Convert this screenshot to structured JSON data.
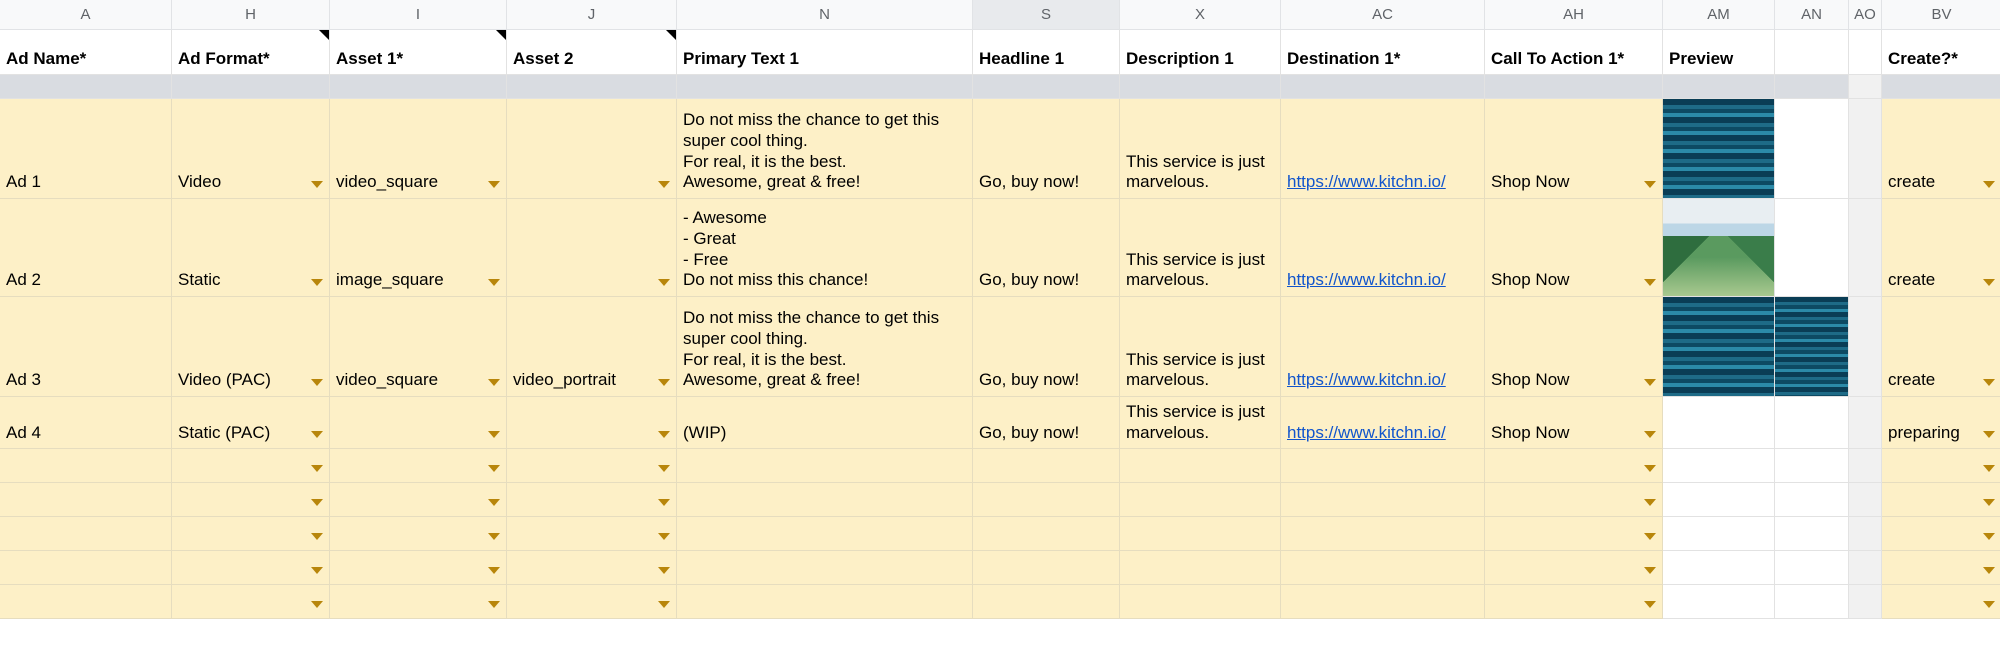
{
  "columns": [
    "A",
    "H",
    "I",
    "J",
    "N",
    "S",
    "X",
    "AC",
    "AH",
    "AM",
    "AN",
    "AO",
    "BV"
  ],
  "selectedColumnIndex": 5,
  "cornerMarkColumns": [
    1,
    2,
    3
  ],
  "fields": [
    "Ad Name*",
    "Ad Format*",
    "Asset 1*",
    "Asset 2",
    "Primary Text 1",
    "Headline 1",
    "Description 1",
    "Destination 1*",
    "Call To Action 1*",
    "Preview",
    "",
    "",
    "Create?*"
  ],
  "rows": [
    {
      "ad_name": "Ad 1",
      "ad_format": "Video",
      "asset1": "video_square",
      "asset2": "",
      "primary": "Do not miss the chance to get this super cool thing.\nFor real, it is the best.\nAwesome, great & free!",
      "headline": "Go, buy now!",
      "description": "This service is just marvelous.",
      "destination": "https://www.kitchn.io/",
      "cta": "Shop Now",
      "preview": "water",
      "preview2": "",
      "create": "create",
      "height": "row-4line"
    },
    {
      "ad_name": "Ad 2",
      "ad_format": "Static",
      "asset1": "image_square",
      "asset2": "",
      "primary": "- Awesome\n- Great\n- Free\nDo not miss this chance!",
      "headline": "Go, buy now!",
      "description": "This service is just marvelous.",
      "destination": "https://www.kitchn.io/",
      "cta": "Shop Now",
      "preview": "mountain",
      "preview2": "",
      "create": "create",
      "height": "row-3"
    },
    {
      "ad_name": "Ad 3",
      "ad_format": "Video (PAC)",
      "asset1": "video_square",
      "asset2": "video_portrait",
      "primary": "Do not miss the chance to get this super cool thing.\nFor real, it is the best.\nAwesome, great & free!",
      "headline": "Go, buy now!",
      "description": "This service is just marvelous.",
      "destination": "https://www.kitchn.io/",
      "cta": "Shop Now",
      "preview": "water",
      "preview2": "water-sm",
      "create": "create",
      "height": "row-4line"
    },
    {
      "ad_name": "Ad 4",
      "ad_format": "Static (PAC)",
      "asset1": "",
      "asset2": "",
      "primary": "(WIP)",
      "headline": "Go, buy now!",
      "description": "This service is just marvelous.",
      "destination": "https://www.kitchn.io/",
      "cta": "Shop Now",
      "preview": "",
      "preview2": "",
      "create": "preparing",
      "height": "row-sm"
    }
  ],
  "emptyRowCount": 5
}
